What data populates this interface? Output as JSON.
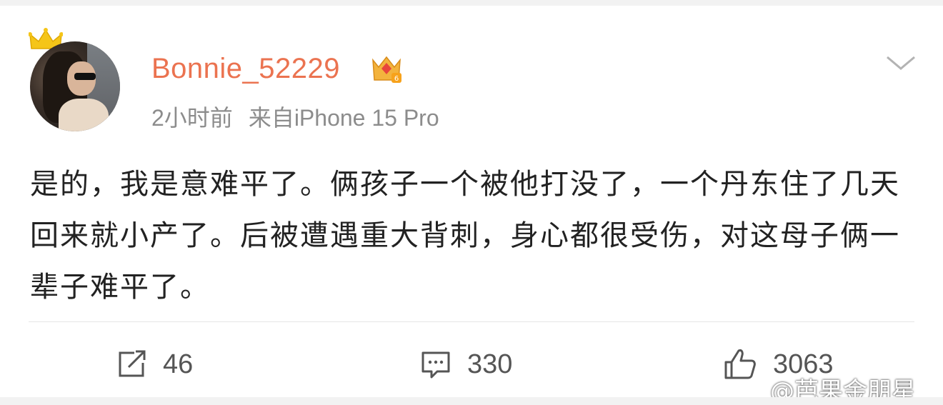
{
  "post": {
    "username": "Bonnie_52229",
    "time": "2小时前",
    "source": "来自iPhone 15 Pro",
    "text": "是的，我是意难平了。俩孩子一个被他打没了，一个丹东住了几天回来就小产了。后被遭遇重大背刺，身心都很受伤，对这母子俩一辈子难平了。"
  },
  "actions": {
    "repost_count": "46",
    "comment_count": "330",
    "like_count": "3063"
  },
  "watermark": "@芭果金朋星",
  "icons": {
    "crown": "crown-icon",
    "vip": "vip-badge-icon",
    "more": "chevron-down-icon",
    "repost": "repost-icon",
    "comment": "comment-icon",
    "like": "thumbs-up-icon"
  },
  "colors": {
    "username": "#eb7350",
    "meta": "#8c8c8c",
    "text": "#222222",
    "crown": "#f5c518"
  }
}
